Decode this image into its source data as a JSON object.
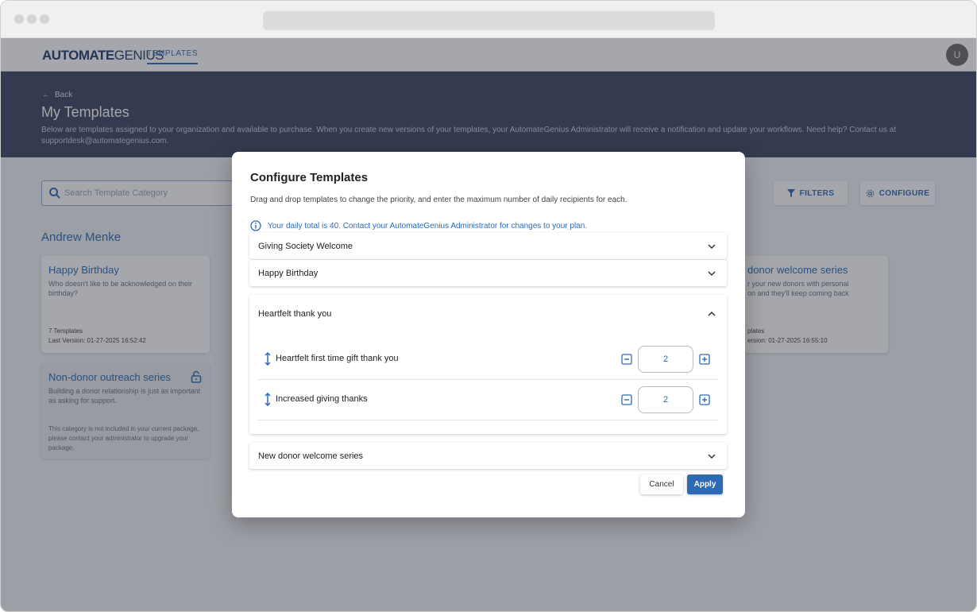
{
  "app": {
    "logo_bold": "AUTOMATE",
    "logo_light": "GENIUS",
    "nav_tab": "TEMPLATES",
    "avatar_initial": "U"
  },
  "hero": {
    "back_label": "Back",
    "title": "My Templates",
    "description": "Below are templates assigned to your organization and available to purchase. When you create new versions of your templates, your AutomateGenius Administrator will receive a notification and update your workflows. Need help? Contact us at supportdesk@automategenius.com."
  },
  "toolbar": {
    "search_placeholder": "Search Template Category",
    "filters_label": "FILTERS",
    "configure_label": "CONFIGURE"
  },
  "section": {
    "owner": "Andrew Menke"
  },
  "cards": [
    {
      "title": "Happy Birthday",
      "description": "Who doesn't like to be acknowledged on their birthday?",
      "count": "7 Templates",
      "version": "Last Version: 01-27-2025 16:52:42"
    },
    {
      "title": "Non-donor outreach series",
      "description": "Building a donor relationship is just as important as asking for support.",
      "locked_message": "This category is not included in your current package, please contact your administrator to upgrade your package."
    },
    {
      "title": "donor welcome series",
      "description": "r your new donors with personal\non and they'll keep coming back",
      "count": "plates",
      "version": "ersion: 01-27-2025 16:55:10"
    }
  ],
  "modal": {
    "title": "Configure Templates",
    "subtitle": "Drag and drop templates to change the priority, and enter the maximum number of daily recipients for each.",
    "info": "Your daily total is 40. Contact your AutomateGenius Administrator for changes to your plan.",
    "groups": [
      {
        "name": "Giving Society Welcome",
        "expanded": false
      },
      {
        "name": "Happy Birthday",
        "expanded": false
      },
      {
        "name": "Heartfelt thank you",
        "expanded": true
      },
      {
        "name": "New donor welcome series",
        "expanded": false
      }
    ],
    "items": [
      {
        "name": "Heartfelt first time gift thank you",
        "qty": "2"
      },
      {
        "name": "Increased giving thanks",
        "qty": "2"
      }
    ],
    "cancel_label": "Cancel",
    "apply_label": "Apply"
  },
  "colors": {
    "accent": "#2d6ab4",
    "hero": "#3d4460"
  }
}
